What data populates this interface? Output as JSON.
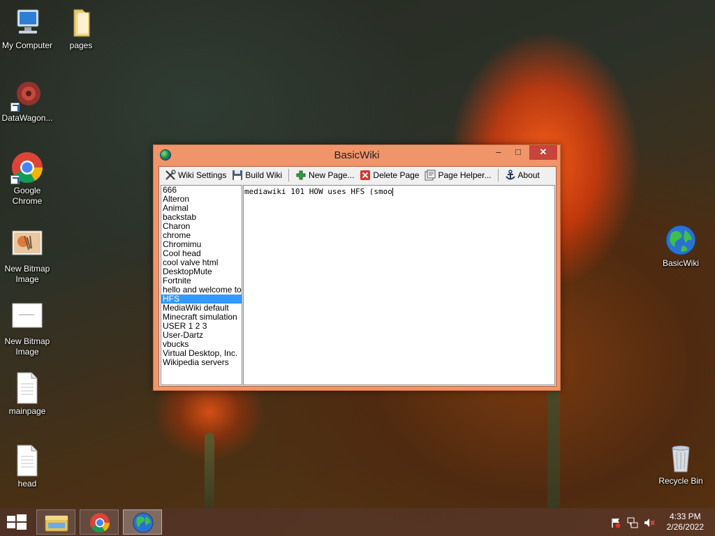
{
  "desktop": {
    "icons": [
      {
        "label": "My Computer"
      },
      {
        "label": "pages"
      },
      {
        "label": "DataWagon..."
      },
      {
        "label": "Google Chrome"
      },
      {
        "label": "New Bitmap Image"
      },
      {
        "label": "New Bitmap Image"
      },
      {
        "label": "mainpage"
      },
      {
        "label": "head"
      },
      {
        "label": "BasicWiki"
      },
      {
        "label": "Recycle Bin"
      }
    ]
  },
  "window": {
    "title": "BasicWiki",
    "controls": {
      "minimize": "–",
      "maximize": "□",
      "close": "✕"
    },
    "toolbar": {
      "wiki_settings": "Wiki Settings",
      "build_wiki": "Build Wiki",
      "new_page": "New Page...",
      "delete_page": "Delete Page",
      "page_helper": "Page Helper...",
      "about": "About"
    },
    "pages": [
      "666",
      "Alteron",
      "Animal",
      "backstab",
      "Charon",
      "chrome",
      "Chromimu",
      "Cool head",
      "cool valve html",
      "DesktopMute",
      "Fortnite",
      "hello and welcome to my",
      "HFS",
      "MediaWiki default",
      "Minecraft simulation",
      "USER 1 2 3",
      "User-Dartz",
      "vbucks",
      "Virtual Desktop, Inc.",
      "Wikipedia servers"
    ],
    "selected_page": "HFS",
    "editor_text": "mediawiki 101 HOW uses HFS (smoo"
  },
  "taskbar": {
    "time": "4:33 PM",
    "date": "2/26/2022",
    "apps": [
      "file-explorer",
      "chrome",
      "basicwiki"
    ],
    "active_app": "basicwiki"
  },
  "colors": {
    "window_frame": "#f0956a",
    "close_button": "#c7443a",
    "selection": "#3399ff"
  }
}
